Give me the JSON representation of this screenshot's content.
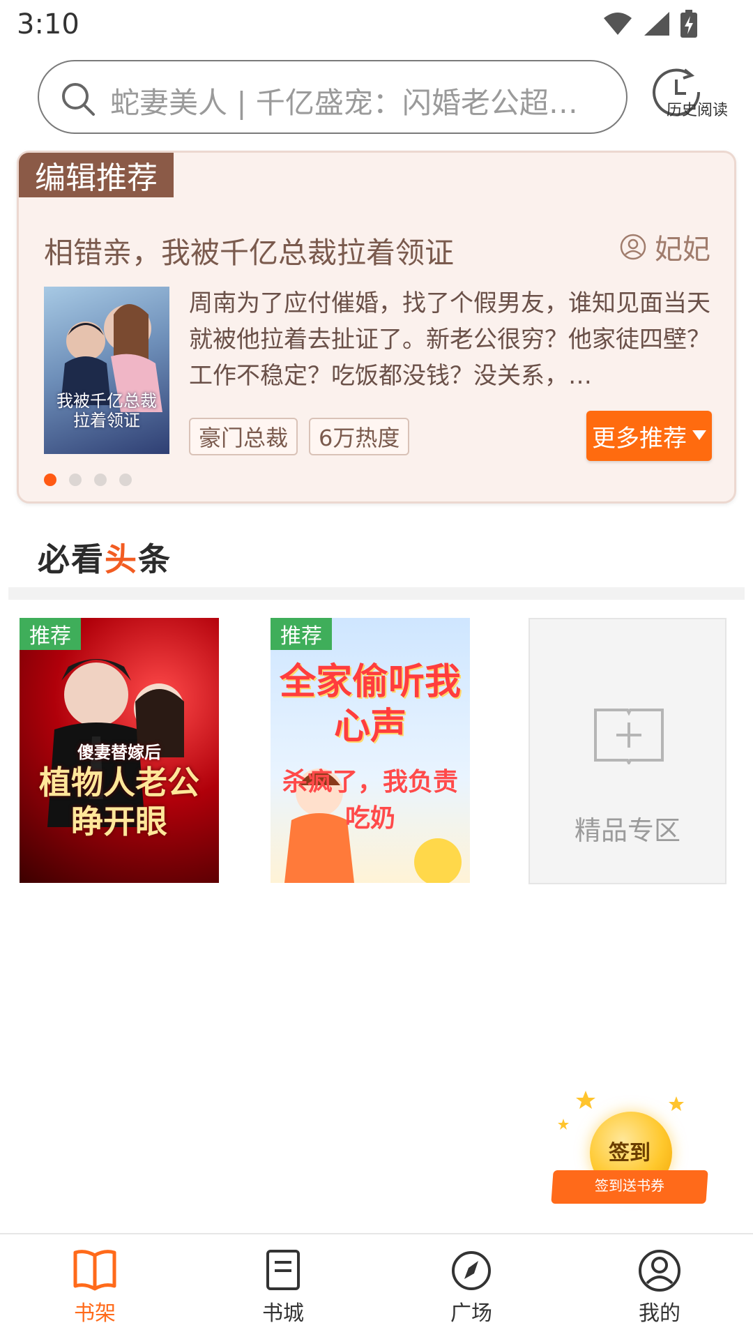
{
  "status_bar": {
    "time": "3:10"
  },
  "search": {
    "placeholder": "蛇妻美人 | 千亿盛宠：闪婚老公超能…",
    "history_label": "历史阅读"
  },
  "editor_recommend": {
    "tag": "编辑推荐",
    "title": "相错亲，我被千亿总裁拉着领证",
    "author": "妃妃",
    "cover_title": "我被千亿总裁拉着领证",
    "description": "周南为了应付催婚，找了个假男友，谁知见面当天就被他拉着去扯证了。新老公很穷？他家徒四壁？工作不稳定？吃饭都没钱？没关系，…",
    "chips": [
      "豪门总裁",
      "6万热度"
    ],
    "more_button": "更多推荐",
    "dots": {
      "count": 4,
      "active_index": 0
    }
  },
  "headline": {
    "title_prefix": "必看",
    "title_accent": "头",
    "title_suffix": "条"
  },
  "books": [
    {
      "tag": "推荐",
      "cover_title": "植物人老公睁开眼",
      "cover_subtitle": "傻妻替嫁后"
    },
    {
      "tag": "推荐",
      "cover_title": "全家偷听我心声",
      "cover_subtitle": "杀疯了，我负责吃奶"
    }
  ],
  "premium_zone": {
    "label": "精品专区"
  },
  "signin": {
    "title": "签到",
    "subtitle": "签到送书券"
  },
  "bottom_nav": {
    "items": [
      {
        "label": "书架",
        "icon": "book-open-icon",
        "active": true
      },
      {
        "label": "书城",
        "icon": "document-icon",
        "active": false
      },
      {
        "label": "广场",
        "icon": "compass-icon",
        "active": false
      },
      {
        "label": "我的",
        "icon": "user-icon",
        "active": false
      }
    ]
  },
  "colors": {
    "accent": "#ff6a1a",
    "card_bg": "#fbf1ed",
    "tag_brown": "#8b5a47",
    "recommend_green": "#3fae5a"
  }
}
